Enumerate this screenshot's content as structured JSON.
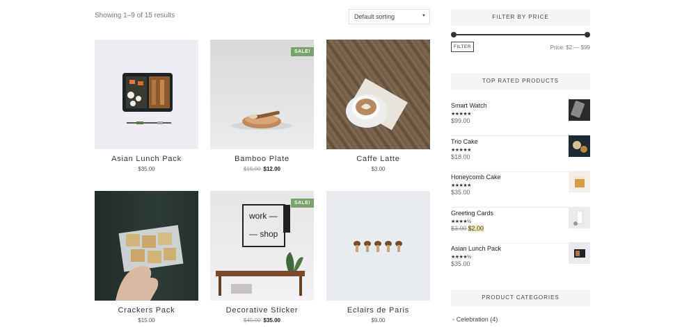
{
  "shop": {
    "results_text": "Showing 1–9 of 15 results",
    "sorting": {
      "selected": "Default sorting"
    }
  },
  "products": [
    {
      "name": "Asian Lunch Pack",
      "price": "$35.00",
      "sale": false
    },
    {
      "name": "Bamboo Plate",
      "old_price": "$15.00",
      "price": "$12.00",
      "sale": true,
      "sale_label": "SALE!"
    },
    {
      "name": "Caffe Latte",
      "price": "$3.00",
      "sale": false
    },
    {
      "name": "Crackers Pack",
      "price": "$15.00",
      "sale": false
    },
    {
      "name": "Decorative Sticker",
      "old_price": "$45.00",
      "price": "$35.00",
      "sale": true,
      "sale_label": "SALE!",
      "image_text": [
        "work —",
        "— shop"
      ]
    },
    {
      "name": "Eclairs de Paris",
      "price": "$9.00",
      "sale": false
    }
  ],
  "sidebar": {
    "filter_by_price": {
      "title": "FILTER BY PRICE",
      "button": "FILTER",
      "price_text": "Price: $2 — $99"
    },
    "top_rated": {
      "title": "TOP RATED PRODUCTS",
      "items": [
        {
          "name": "Smart Watch",
          "price": "$99.00",
          "rating": 5
        },
        {
          "name": "Trio Cake",
          "price": "$18.00",
          "rating": 5
        },
        {
          "name": "Honeycomb Cake",
          "price": "$35.00",
          "rating": 5
        },
        {
          "name": "Greeting Cards",
          "old_price": "$3.00",
          "price": "$2.00",
          "rating": 4.5
        },
        {
          "name": "Asian Lunch Pack",
          "price": "$35.00",
          "rating": 4.5
        }
      ]
    },
    "categories": {
      "title": "PRODUCT CATEGORIES",
      "items": [
        {
          "label": "Celebration (4)"
        }
      ]
    }
  },
  "colors": {
    "sale_badge": "#7aa36b",
    "price_highlight": "#f7f1b8"
  }
}
